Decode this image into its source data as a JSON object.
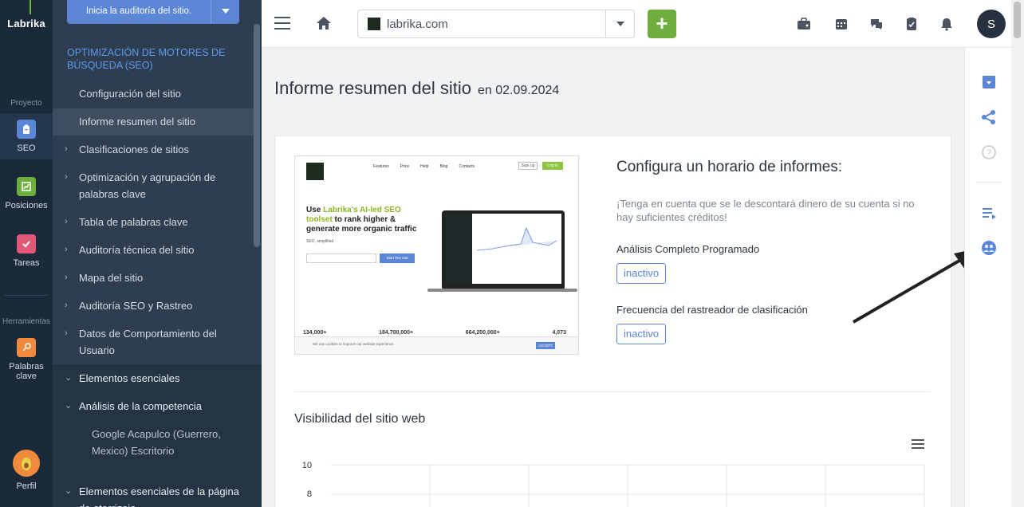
{
  "rail": {
    "logo": "Labrika",
    "section_project": "Proyecto",
    "section_tools": "Herramientas",
    "items": [
      {
        "label": "SEO",
        "icon": "clipboard-icon",
        "color": "#5b86d6"
      },
      {
        "label": "Posiciones",
        "icon": "chart-icon",
        "color": "#6fae3c"
      },
      {
        "label": "Tareas",
        "icon": "check-icon",
        "color": "#e05a78"
      },
      {
        "label": "Palabras clave",
        "icon": "key-icon",
        "color": "#f08a3c"
      },
      {
        "label": "Perfil",
        "icon": "avocado-icon",
        "color": "#f08a3c"
      }
    ]
  },
  "sidebar": {
    "audit_button": "Inicia la auditoría del sitio.",
    "heading": "OPTIMIZACIÓN DE MOTORES DE BÚSQUEDA (SEO)",
    "items": [
      "Configuración del sitio",
      "Informe resumen del sitio",
      "Clasificaciones de sitios",
      "Optimización y agrupación de palabras clave",
      "Tabla de palabras clave",
      "Auditoría técnica del sitio",
      "Mapa del sitio",
      "Auditoría SEO y Rastreo",
      "Datos de Comportamiento del Usuario"
    ],
    "sections": [
      "Elementos esenciales",
      "Análisis de la competencia",
      "Elementos esenciales de la página de aterrizaje"
    ],
    "sub_item": "Google Acapulco (Guerrero, Mexico) Escritorio"
  },
  "topbar": {
    "site": "labrika.com",
    "plus": "+",
    "user_initial": "S",
    "icons": [
      "briefcase-icon",
      "calendar-icon",
      "chat-icon",
      "clipboard-check-icon",
      "bell-icon"
    ]
  },
  "main": {
    "title": "Informe resumen del sitio",
    "date": "en 02.09.2024",
    "schedule": {
      "title": "Configura un horario de informes:",
      "note": "¡Tenga en cuenta que se le descontará dinero de su cuenta si no hay suficientes créditos!",
      "full_analysis_label": "Análisis Completo Programado",
      "full_analysis_status": "inactivo",
      "crawler_label": "Frecuencia del rastreador de clasificación",
      "crawler_status": "inactivo"
    },
    "visibility_title": "Visibilidad del sitio web",
    "y_ticks": [
      "10",
      "8"
    ]
  },
  "thumbnail": {
    "headline_1": "Use ",
    "headline_accent": "Labrika's AI-led SEO toolset",
    "headline_2": " to rank higher & generate more organic traffic",
    "nav": [
      "Features",
      "Price",
      "Help",
      "Blog",
      "Contacts"
    ],
    "login": "Log in",
    "signup": "Sign up",
    "stats": [
      "134,000+",
      "184,700,000+",
      "664,200,000+",
      "4,073"
    ],
    "seo_simplified": "SEO, simplified",
    "start": "Start free trial",
    "cookie": "We use cookies to improve our website experience.",
    "accept": "ACCEPT"
  },
  "right_rail": {
    "icons": [
      "archive-icon",
      "share-icon",
      "help-icon",
      "list-icon",
      "competitors-icon"
    ]
  }
}
